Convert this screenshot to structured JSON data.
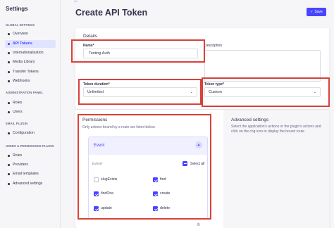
{
  "sidebar": {
    "title": "Settings",
    "sections": [
      {
        "label": "GLOBAL SETTINGS",
        "items": [
          "Overview",
          "API Tokens",
          "Internationalization",
          "Media Library",
          "Transfer Tokens",
          "Webhooks"
        ]
      },
      {
        "label": "ADMINISTRATION PANEL",
        "items": [
          "Roles",
          "Users"
        ]
      },
      {
        "label": "EMAIL PLUGIN",
        "items": [
          "Configuration"
        ]
      },
      {
        "label": "USERS & PERMISSIONS PLUGIN",
        "items": [
          "Roles",
          "Providers",
          "Email templates",
          "Advanced settings"
        ]
      }
    ],
    "active_item": "API Tokens"
  },
  "header": {
    "title": "Create API Token",
    "save_label": "Save"
  },
  "details": {
    "heading": "Details",
    "name_label": "Name*",
    "name_value": "Testing Auth",
    "description_label": "Description",
    "duration_label": "Token duration*",
    "duration_value": "Unlimited",
    "type_label": "Token type*",
    "type_value": "Custom"
  },
  "permissions": {
    "heading": "Permissions",
    "subtitle": "Only actions bound by a route are listed below.",
    "accordion_title": "Event",
    "section_caption": "EVENT",
    "select_all_label": "Select all",
    "actions": [
      {
        "label": "slugExists",
        "checked": false
      },
      {
        "label": "find",
        "checked": true
      },
      {
        "label": "findOne",
        "checked": true
      },
      {
        "label": "create",
        "checked": true
      },
      {
        "label": "update",
        "checked": true
      },
      {
        "label": "delete",
        "checked": true
      }
    ]
  },
  "advanced": {
    "heading": "Advanced settings",
    "text": "Select the application's actions or the plugin's actions and click on the cog icon to display the bound route"
  },
  "colors": {
    "accent": "#4945ff",
    "highlight": "#d8423a"
  }
}
